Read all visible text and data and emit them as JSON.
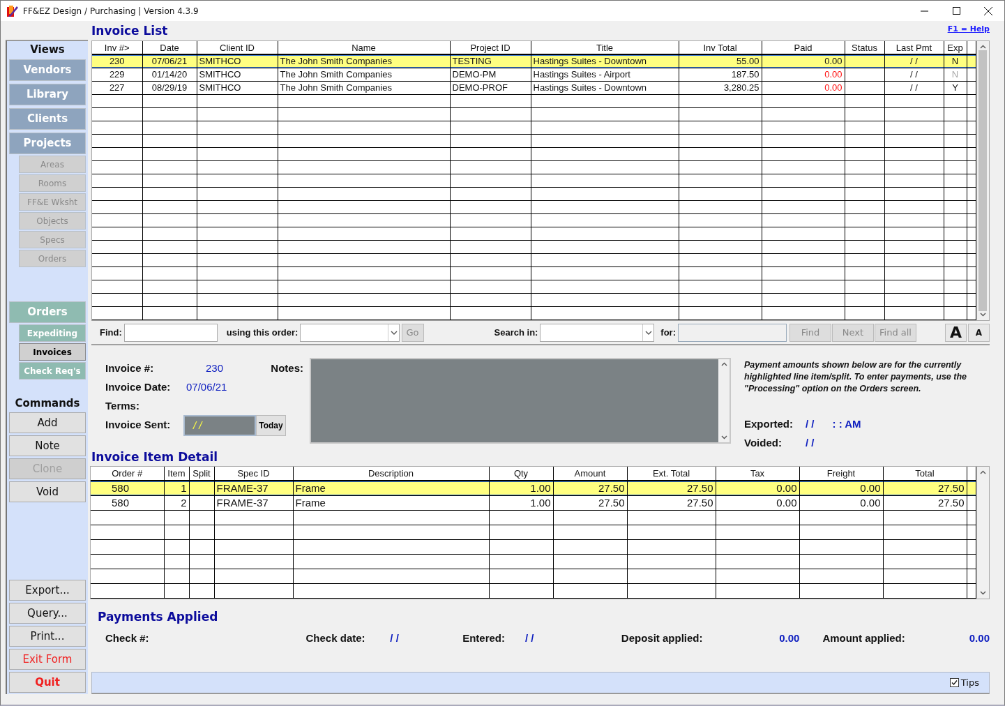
{
  "window": {
    "title": "FF&EZ Design / Purchasing | Version 4.3.9"
  },
  "sidebar": {
    "views_title": "Views",
    "views": [
      {
        "label": "Vendors",
        "kind": "main",
        "color": "#8ea4be",
        "disabled": false,
        "selected": false
      },
      {
        "label": "Library",
        "kind": "main",
        "color": "#8ea4be",
        "disabled": false,
        "selected": false
      },
      {
        "label": "Clients",
        "kind": "main",
        "color": "#8ea4be",
        "disabled": false,
        "selected": false
      },
      {
        "label": "Projects",
        "kind": "main",
        "color": "#8ea4be",
        "disabled": false,
        "selected": false
      },
      {
        "label": "Areas",
        "kind": "sub",
        "color": "#d0d0d0",
        "disabled": true,
        "selected": false
      },
      {
        "label": "Rooms",
        "kind": "sub",
        "color": "#d0d0d0",
        "disabled": true,
        "selected": false
      },
      {
        "label": "FF&E Wksht",
        "kind": "sub",
        "color": "#d0d0d0",
        "disabled": true,
        "selected": false
      },
      {
        "label": "Objects",
        "kind": "sub",
        "color": "#d0d0d0",
        "disabled": true,
        "selected": false
      },
      {
        "label": "Specs",
        "kind": "sub",
        "color": "#d0d0d0",
        "disabled": true,
        "selected": false
      },
      {
        "label": "Orders",
        "kind": "sub",
        "color": "#d0d0d0",
        "disabled": true,
        "selected": false
      },
      {
        "label": "Orders",
        "kind": "main",
        "color": "#8fbbb1",
        "disabled": false,
        "selected": false
      },
      {
        "label": "Expediting",
        "kind": "sub",
        "color": "#8fbbb1",
        "disabled": false,
        "selected": false
      },
      {
        "label": "Invoices",
        "kind": "sub",
        "color": "#d0d0d0",
        "disabled": false,
        "selected": true
      },
      {
        "label": "Check Req's",
        "kind": "sub",
        "color": "#8fbbb1",
        "disabled": false,
        "selected": false
      }
    ],
    "commands_title": "Commands",
    "commands": [
      {
        "label": "Add",
        "kind": "normal",
        "disabled": false
      },
      {
        "label": "Note",
        "kind": "normal",
        "disabled": false
      },
      {
        "label": "Clone",
        "kind": "normal",
        "disabled": true
      },
      {
        "label": "Void",
        "kind": "normal",
        "disabled": false
      },
      {
        "label": "Export...",
        "kind": "normal",
        "disabled": false
      },
      {
        "label": "Query...",
        "kind": "normal",
        "disabled": false
      },
      {
        "label": "Print...",
        "kind": "normal",
        "disabled": false
      },
      {
        "label": "Exit Form",
        "kind": "warn",
        "disabled": false
      },
      {
        "label": "Quit",
        "kind": "danger",
        "disabled": false
      }
    ]
  },
  "invoice_list": {
    "title": "Invoice List",
    "help": "F1 = Help",
    "columns": [
      "Inv #>",
      "Date",
      "Client ID",
      "Name",
      "Project ID",
      "Title",
      "Inv Total",
      "Paid",
      "Status",
      "Last Pmt",
      "Exp"
    ],
    "rows": [
      {
        "selected": true,
        "paid_alert": false,
        "exp_dimmed": false,
        "cells": [
          "230",
          "07/06/21",
          "SMITHCO",
          "The John Smith Companies",
          "TESTING",
          "Hastings Suites - Downtown",
          "55.00",
          "0.00",
          null,
          "/ /",
          "N"
        ]
      },
      {
        "selected": false,
        "paid_alert": true,
        "exp_dimmed": true,
        "cells": [
          "229",
          "01/14/20",
          "SMITHCO",
          "The John Smith Companies",
          "DEMO-PM",
          "Hastings Suites - Airport",
          "187.50",
          "0.00",
          null,
          "/ /",
          "N"
        ]
      },
      {
        "selected": false,
        "paid_alert": true,
        "exp_dimmed": false,
        "cells": [
          "227",
          "08/29/19",
          "SMITHCO",
          "The John Smith Companies",
          "DEMO-PROF",
          "Hastings Suites - Downtown",
          "3,280.25",
          "0.00",
          null,
          "/ /",
          "Y"
        ]
      }
    ]
  },
  "search_bar": {
    "find_label": "Find:",
    "order_label": "using this order:",
    "go": "Go",
    "search_in_label": "Search in:",
    "for_label": "for:",
    "buttons": [
      {
        "label": "Find",
        "disabled": true
      },
      {
        "label": "Next",
        "disabled": true
      },
      {
        "label": "Find all",
        "disabled": true
      }
    ],
    "font_buttons": [
      {
        "label": "A",
        "kind": "large"
      },
      {
        "label": "A",
        "kind": "small"
      }
    ]
  },
  "invoice": {
    "fields": [
      {
        "label": "Invoice #:",
        "value": "230"
      },
      {
        "label": "Invoice Date:",
        "value": "07/06/21"
      },
      {
        "label": "Terms:"
      }
    ],
    "sent_label": "Invoice Sent:",
    "sent_value": "/ /",
    "today": "Today",
    "notes_label": "Notes:",
    "payment_note": "Payment amounts shown below are for the currently highlighted line item/split.  To enter payments, use the \"Processing\" option on the Orders screen.",
    "exported_label": "Exported:",
    "exported_date": "/ /",
    "exported_time": ": :  AM",
    "voided_label": "Voided:",
    "voided_date": "/ /"
  },
  "item_detail": {
    "title": "Invoice Item Detail",
    "columns": [
      "Order #",
      "Item",
      "Split",
      "Spec ID",
      "Description",
      "Qty",
      "Amount",
      "Ext. Total",
      "Tax",
      "Freight",
      "Total"
    ],
    "rows": [
      {
        "selected": true,
        "cells": [
          "580",
          "1",
          null,
          "FRAME-37",
          "Frame",
          "1.00",
          "27.50",
          "27.50",
          "0.00",
          "0.00",
          "27.50"
        ]
      },
      {
        "selected": false,
        "cells": [
          "580",
          "2",
          null,
          "FRAME-37",
          "Frame",
          "1.00",
          "27.50",
          "27.50",
          "0.00",
          "0.00",
          "27.50"
        ]
      }
    ]
  },
  "payments": {
    "title": "Payments Applied",
    "fields": [
      {
        "label": "Check #:"
      },
      {
        "label": "Check date:",
        "value": "/ /"
      },
      {
        "label": "Entered:",
        "value": "/ /"
      },
      {
        "label": "Deposit applied:",
        "value": "0.00"
      },
      {
        "label": "Amount applied:",
        "value": "0.00"
      }
    ]
  },
  "status_bar": {
    "tips": {
      "label": "Tips",
      "checked": true
    }
  }
}
